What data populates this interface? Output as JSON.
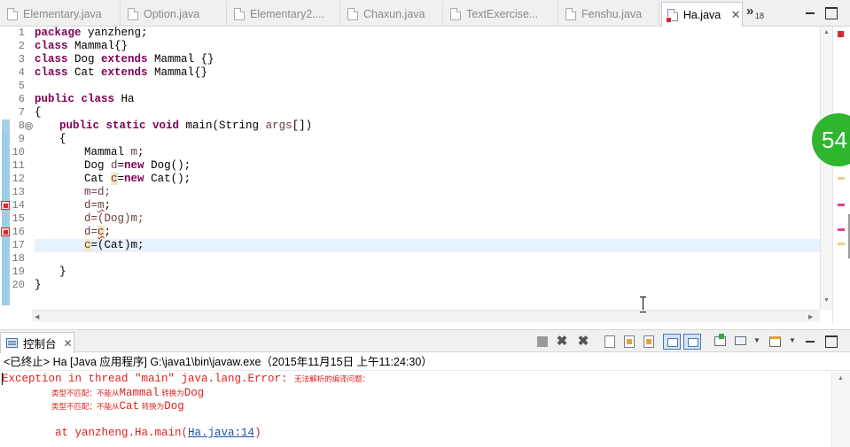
{
  "editor_tabs": [
    {
      "label": "Elementary.java",
      "active": false,
      "error": false
    },
    {
      "label": "Option.java",
      "active": false,
      "error": false
    },
    {
      "label": "Elementary2....",
      "active": false,
      "error": false
    },
    {
      "label": "Chaxun.java",
      "active": false,
      "error": false
    },
    {
      "label": "TextExercise...",
      "active": false,
      "error": false
    },
    {
      "label": "Fenshu.java",
      "active": false,
      "error": false
    },
    {
      "label": "Ha.java",
      "active": true,
      "error": true
    }
  ],
  "tab_close_glyph": "✕",
  "overflow": {
    "glyph": "»",
    "count": "18"
  },
  "editor": {
    "line_numbers": [
      "1",
      "2",
      "3",
      "4",
      "5",
      "6",
      "7",
      "8",
      "9",
      "10",
      "11",
      "12",
      "13",
      "14",
      "15",
      "16",
      "17",
      "18",
      "19",
      "20"
    ],
    "code": {
      "l1_kw": "package",
      "l1_rest": " yanzheng;",
      "l2_kw": "class",
      "l2_rest": " Mammal{}",
      "l3_kw1": "class",
      "l3_mid": " Dog ",
      "l3_kw2": "extends",
      "l3_rest": " Mammal {}",
      "l4_kw1": "class",
      "l4_mid": " Cat ",
      "l4_kw2": "extends",
      "l4_rest": " Mammal{}",
      "l6_kw": "public class",
      "l6_rest": " Ha",
      "l7": "{",
      "l8_kw": "public static void",
      "l8_rest": " main(String ",
      "l8_args": "args",
      "l8_end": "[])",
      "l9": "{",
      "l10_a": "Mammal ",
      "l10_b": "m",
      "l10_c": ";",
      "l11_a": "Dog ",
      "l11_b": "d",
      "l11_c": "=",
      "l11_kw": "new",
      "l11_d": " Dog();",
      "l12_a": "Cat ",
      "l12_b": "c",
      "l12_c": "=",
      "l12_kw": "new",
      "l12_d": " Cat();",
      "l13": "m=d;",
      "l14_a": "d=",
      "l14_b": "m",
      "l14_c": ";",
      "l15": "d=(Dog)m;",
      "l16_a": "d=",
      "l16_b": "c",
      "l16_c": ";",
      "l17_a": "c",
      "l17_b": "=(Cat)m;",
      "l19": "}",
      "l20": "}"
    },
    "fold_glyph": "⊖",
    "error_lines": [
      14,
      16
    ],
    "current_line": 17
  },
  "overlay_badge": "54",
  "console": {
    "tab_label": "控制台",
    "tab_close": "✕",
    "status": "<已终止> Ha [Java 应用程序] G:\\java1\\bin\\javaw.exe（2015年11月15日 上午11:24:30）",
    "output": {
      "l1_a": "Exception in thread \"main\" java.lang.Error: ",
      "l1_b": "无法解析的编译问题：",
      "l2_a": "类型不匹配：不能从",
      "l2_b": "Mammal",
      "l2_c": " 转换为",
      "l2_d": "Dog",
      "l3_a": "类型不匹配：不能从",
      "l3_b": "Cat",
      "l3_c": " 转换为",
      "l3_d": "Dog",
      "l5_a": "\tat yanzheng.Ha.main(",
      "l5_link": "Ha.java:14",
      "l5_b": ")"
    }
  },
  "colors": {
    "keyword": "#7f0055",
    "error": "#e0201f",
    "link": "#1a4fa8",
    "current_line": "#e8f2fe",
    "badge": "#2fb52f"
  }
}
